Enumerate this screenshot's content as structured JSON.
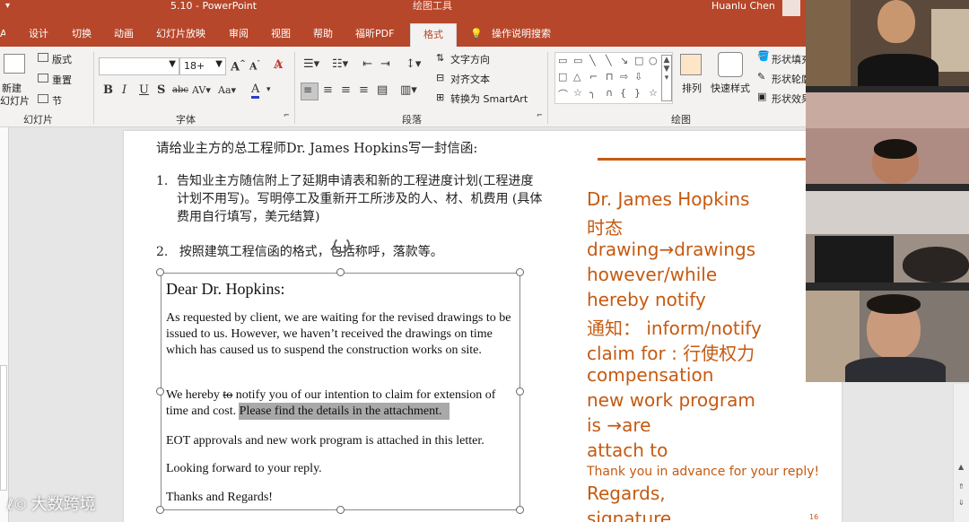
{
  "window": {
    "title": "5.10  -  PowerPoint",
    "context_tab": "绘图工具",
    "user": "Huanlu Chen"
  },
  "tabs": [
    {
      "label": "设计"
    },
    {
      "label": "切换"
    },
    {
      "label": "动画"
    },
    {
      "label": "幻灯片放映"
    },
    {
      "label": "审阅"
    },
    {
      "label": "视图"
    },
    {
      "label": "帮助"
    },
    {
      "label": "福昕PDF"
    },
    {
      "label": "格式"
    },
    {
      "label": "操作说明搜索"
    }
  ],
  "ribbon": {
    "slides_group": {
      "new_slide": "新建",
      "new_slide_2": "幻灯片",
      "layout": "版式",
      "reset": "重置",
      "section": "节",
      "label": "幻灯片"
    },
    "font_group": {
      "font_size": "18+",
      "label": "字体"
    },
    "paragraph_group": {
      "text_direction": "文字方向",
      "align_text": "对齐文本",
      "smartart": "转换为 SmartArt",
      "label": "段落"
    },
    "drawing_group": {
      "arrange": "排列",
      "quick_styles": "快速样式",
      "fill": "形状填充",
      "outline": "形状轮廓",
      "effects": "形状效果",
      "label": "绘图"
    }
  },
  "slide": {
    "intro": "请给业主方的总工程师Dr. James Hopkins写一封信函:",
    "item1_num": "1.",
    "item1": "告知业主方随信附上了延期申请表和新的工程进度计划(工程进度计划不用写)。写明停工及重新开工所涉及的人、材、机费用 (具体费用自行填写，美元结算)",
    "item2_num": "2.",
    "item2": "按照建筑工程信函的格式，包括称呼，落款等。",
    "letter": {
      "greeting": "Dear Dr. Hopkins:",
      "para1": "As requested by client, we are waiting for the revised drawings to be issued to us. However, we haven’t received the drawings on time which has caused us to suspend the construction works on site.",
      "para2_a": "We hereby ",
      "para2_strike": "to",
      "para2_b": " notify you of our intention to claim for extension of time and cost. ",
      "para2_hl": "Please find the details in the attachment.",
      "para3": "EOT approvals and new work program is attached in this letter.",
      "para4": "Looking forward to your reply.",
      "para5": "Thanks and Regards!"
    },
    "notes": [
      "Dr. James Hopkins",
      "时态",
      "drawing→drawings",
      "however/while",
      "hereby notify",
      "通知： inform/notify",
      "claim for : 行使权力",
      "compensation",
      "new work program",
      "is →are",
      "attach to",
      "Thank you in advance for your reply!",
      "Regards,",
      "signature"
    ],
    "page_number": "16"
  },
  "watermark": "大数跨境",
  "colors": {
    "accent": "#b7472a",
    "notes": "#c55a11"
  }
}
